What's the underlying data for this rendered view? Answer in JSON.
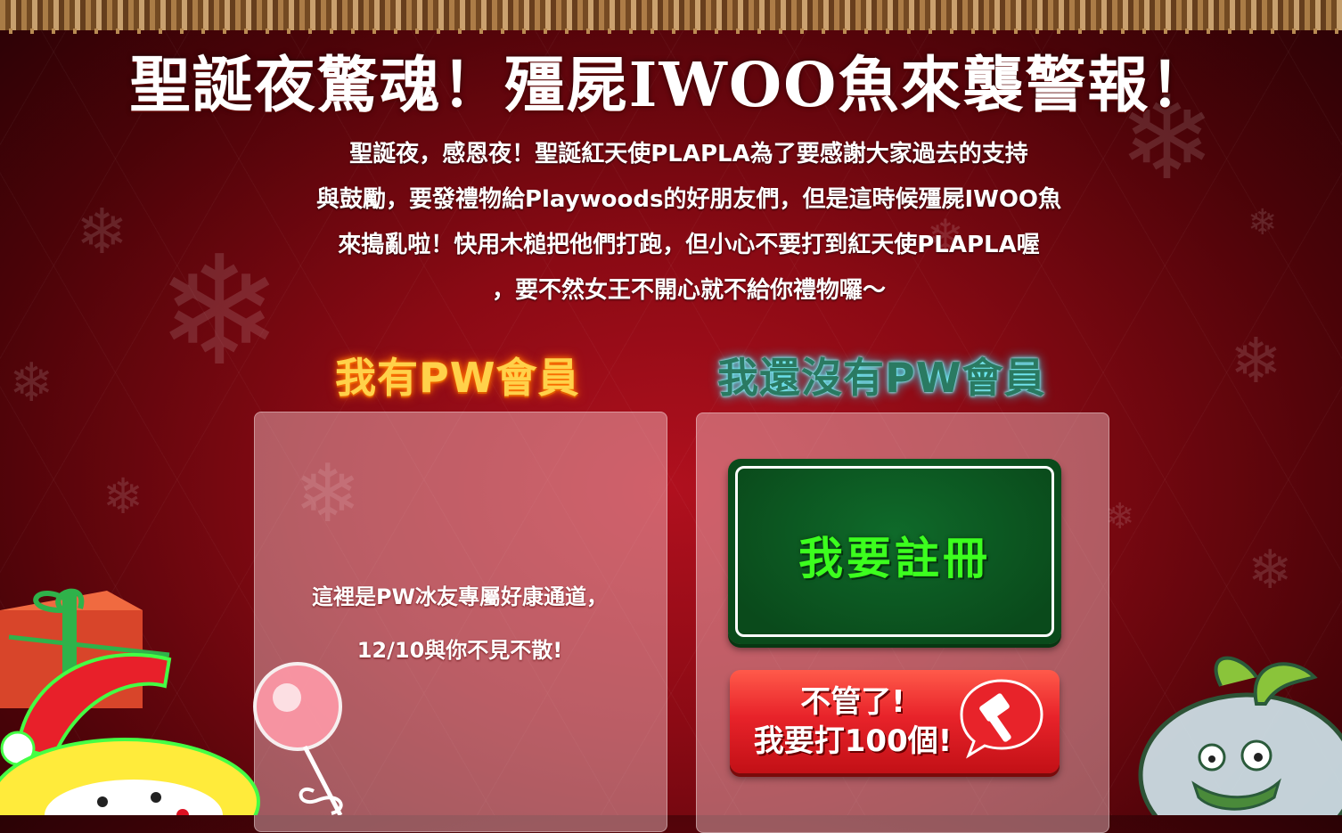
{
  "title": "聖誕夜驚魂！殭屍IWOO魚來襲警報！",
  "intro_lines": [
    "聖誕夜，感恩夜！聖誕紅天使PLAPLA為了要感謝大家過去的支持",
    "與鼓勵，要發禮物給Playwoods的好朋友們，但是這時候殭屍IWOO魚",
    "來搗亂啦！快用木槌把他們打跑，但小心不要打到紅天使PLAPLA喔",
    "，要不然女王不開心就不給你禮物囉～"
  ],
  "member_section": {
    "heading": "我有PW會員",
    "note_lines": [
      "這裡是PW冰友專屬好康通道，",
      "12/10與你不見不散!"
    ]
  },
  "nonmember_section": {
    "heading": "我還沒有PW會員",
    "register_label": "我要註冊",
    "play_label_lines": [
      "不管了!",
      "我要打100個!"
    ]
  },
  "icons": {
    "hammer": "hammer-icon",
    "snowflake": "snowflake-icon",
    "gift": "gift-box-icon"
  },
  "colors": {
    "background": "#8a0a14",
    "member_heading": "#ffd14a",
    "nonmember_heading_glow": "#29d8f0",
    "register_button": "#0a4a1b",
    "register_label": "#3cff1e",
    "play_button": "#e8232a"
  }
}
